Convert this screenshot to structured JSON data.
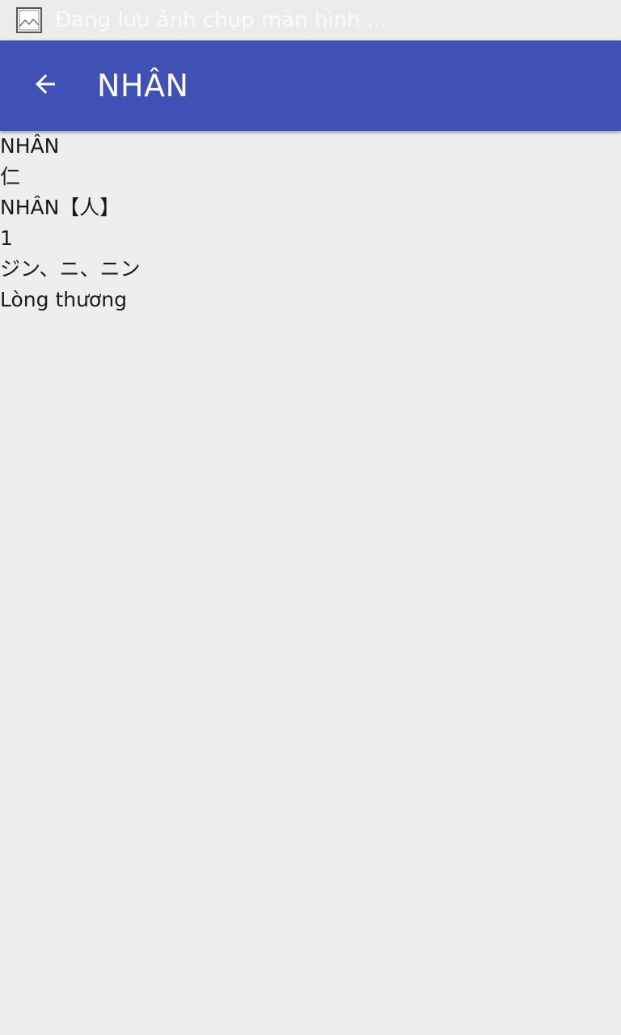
{
  "status_bar": {
    "icon": "image-icon",
    "notification_text": "Đang lưu ảnh chụp màn hình ..."
  },
  "app_bar": {
    "back_icon": "arrow-back-icon",
    "title": "NHÂN",
    "color": "#3f51b5"
  },
  "content": {
    "lines": [
      "NHÂN",
      "仁",
      "NHÂN【人】",
      "1",
      "ジン、ニ、ニン",
      "Lòng thương"
    ]
  }
}
